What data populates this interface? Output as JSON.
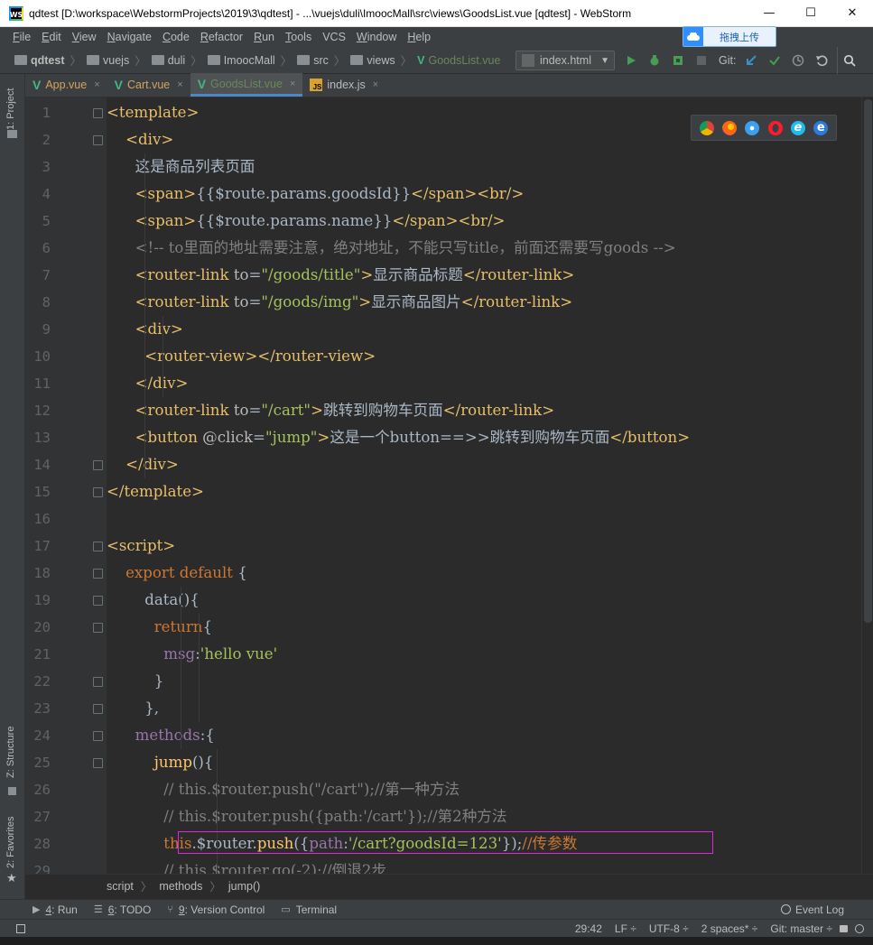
{
  "window": {
    "title": "qdtest [D:\\workspace\\WebstormProjects\\2019\\3\\qdtest] - ...\\vuejs\\duli\\ImoocMall\\src\\views\\GoodsList.vue [qdtest] - WebStorm",
    "app_icon": "WS"
  },
  "menu": [
    {
      "u": "F",
      "rest": "ile"
    },
    {
      "u": "E",
      "rest": "dit"
    },
    {
      "u": "V",
      "rest": "iew"
    },
    {
      "u": "N",
      "rest": "avigate"
    },
    {
      "u": "C",
      "rest": "ode"
    },
    {
      "u": "R",
      "rest": "efactor"
    },
    {
      "u": "R",
      "rest": "un"
    },
    {
      "u": "T",
      "rest": "ools"
    },
    {
      "u": "",
      "rest": "VCS"
    },
    {
      "u": "W",
      "rest": "indow"
    },
    {
      "u": "H",
      "rest": "elp"
    }
  ],
  "upload_widget": {
    "label": "拖拽上传"
  },
  "breadcrumb": [
    "qdtest",
    "vuejs",
    "duli",
    "ImoocMall",
    "src",
    "views",
    "GoodsList.vue"
  ],
  "run_config": "index.html",
  "git_label": "Git:",
  "tabs": [
    {
      "label": "App.vue",
      "type": "vue",
      "active": false
    },
    {
      "label": "Cart.vue",
      "type": "vue",
      "active": false
    },
    {
      "label": "GoodsList.vue",
      "type": "vue",
      "active": true
    },
    {
      "label": "index.js",
      "type": "js",
      "active": false
    }
  ],
  "side_tabs": {
    "project": "1: Project",
    "structure": "Z: Structure",
    "favorites": "2: Favorites"
  },
  "line_numbers": [
    "1",
    "2",
    "3",
    "4",
    "5",
    "6",
    "7",
    "8",
    "9",
    "10",
    "11",
    "12",
    "13",
    "14",
    "15",
    "16",
    "17",
    "18",
    "19",
    "20",
    "21",
    "22",
    "23",
    "24",
    "25",
    "26",
    "27",
    "28",
    "29"
  ],
  "code_lines": [
    "<template>",
    "    <div>",
    "      这是商品列表页面",
    "      <span>{{$route.params.goodsId}}</span><br/>",
    "      <span>{{$route.params.name}}</span><br/>",
    "      <!-- to里面的地址需要注意，绝对地址，不能只写title，前面还需要写goods -->",
    "      <router-link to=\"/goods/title\">显示商品标题</router-link>",
    "      <router-link to=\"/goods/img\">显示商品图片</router-link>",
    "      <div>",
    "        <router-view></router-view>",
    "      </div>",
    "      <router-link to=\"/cart\">跳转到购物车页面</router-link>",
    "      <button @click=\"jump\">这是一个button==>>跳转到购物车页面</button>",
    "    </div>",
    "</template>",
    "",
    "<script>",
    "    export default {",
    "        data(){",
    "          return{",
    "            msg:'hello vue'",
    "          }",
    "        },",
    "      methods:{",
    "          jump(){",
    "            // this.$router.push(\"/cart\");//第一种方法",
    "            // this.$router.push({path:'/cart'});//第2种方法",
    "            this.$router.push({path:'/cart?goodsId=123'});//传参数",
    "            // this.$router.go(-2);//倒退2步"
  ],
  "editor_breadcrumb": [
    "script",
    "methods",
    "jump()"
  ],
  "tool_windows": [
    {
      "u": "4",
      "label": ": Run",
      "icon": "▶"
    },
    {
      "u": "6",
      "label": ": TODO",
      "icon": "☰"
    },
    {
      "u": "9",
      "label": ": Version Control",
      "icon": "⑂"
    },
    {
      "u": "",
      "label": "Terminal",
      "icon": "▭"
    }
  ],
  "event_log": "Event Log",
  "status": {
    "position": "29:42",
    "line_sep": "LF ÷",
    "encoding": "UTF-8 ÷",
    "indent": "2 spaces* ÷",
    "vcs": "Git: master ÷"
  },
  "colors": {
    "tag": "#e8bf6a",
    "string": "#a5c25c",
    "keyword": "#cc7832",
    "comment": "#808080",
    "highlight_box": "#e026e0"
  }
}
